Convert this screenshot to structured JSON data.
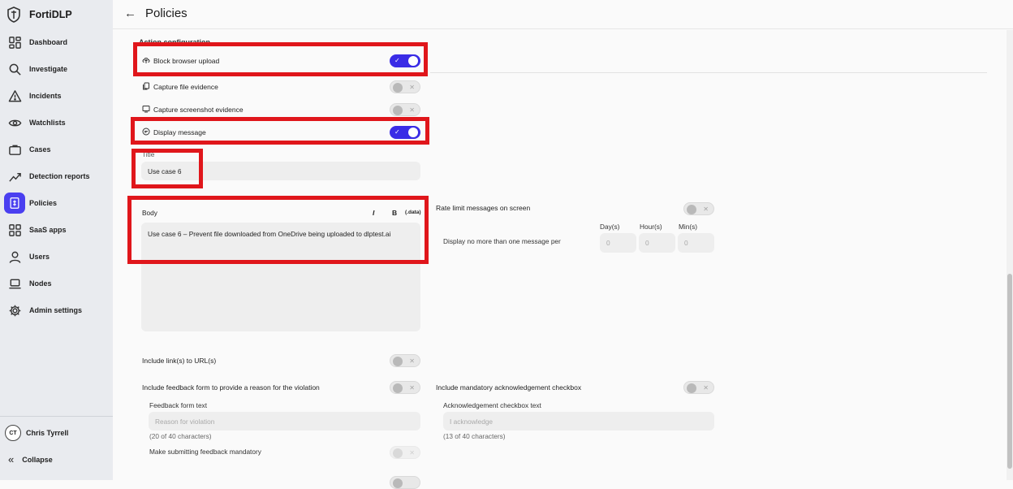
{
  "app": {
    "name": "FortiDLP"
  },
  "sidebar": {
    "items": [
      {
        "label": "Dashboard",
        "icon": "dashboard-icon"
      },
      {
        "label": "Investigate",
        "icon": "search-icon"
      },
      {
        "label": "Incidents",
        "icon": "warning-icon"
      },
      {
        "label": "Watchlists",
        "icon": "eye-icon"
      },
      {
        "label": "Cases",
        "icon": "briefcase-icon"
      },
      {
        "label": "Detection reports",
        "icon": "chart-line-icon"
      },
      {
        "label": "Policies",
        "icon": "policy-icon",
        "active": true
      },
      {
        "label": "SaaS apps",
        "icon": "apps-icon"
      },
      {
        "label": "Users",
        "icon": "user-icon"
      },
      {
        "label": "Nodes",
        "icon": "laptop-icon"
      },
      {
        "label": "Admin settings",
        "icon": "gear-icon"
      }
    ],
    "user": {
      "initials": "CT",
      "name": "Chris Tyrrell"
    },
    "collapse_label": "Collapse"
  },
  "header": {
    "title": "Policies"
  },
  "action_config": {
    "heading": "Action configuration",
    "block_browser_upload": {
      "label": "Block browser upload",
      "on": true
    },
    "capture_file_evidence": {
      "label": "Capture file evidence",
      "on": false
    },
    "capture_screenshot_evidence": {
      "label": "Capture screenshot evidence",
      "on": false
    },
    "display_message": {
      "label": "Display message",
      "on": true
    }
  },
  "message": {
    "title_label": "Title",
    "title_value": "Use case 6",
    "body_label": "Body",
    "format_italic": "I",
    "format_bold": "B",
    "format_data": "(.data)",
    "body_value": "Use case 6 – Prevent file downloaded from OneDrive being uploaded to dlptest.ai"
  },
  "rate_limit": {
    "label": "Rate limit messages on screen",
    "on": false,
    "description": "Display no more than one message per",
    "days_label": "Day(s)",
    "hours_label": "Hour(s)",
    "mins_label": "Min(s)",
    "days_value": "0",
    "hours_value": "0",
    "mins_value": "0"
  },
  "include_links": {
    "label": "Include link(s) to URL(s)",
    "on": false
  },
  "feedback": {
    "label": "Include feedback form to provide a reason for the violation",
    "on": false,
    "form_text_label": "Feedback form text",
    "placeholder": "Reason for violation",
    "char_count": "(20 of 40 characters)",
    "mandatory_label": "Make submitting feedback mandatory"
  },
  "acknowledgement": {
    "label": "Include mandatory acknowledgement checkbox",
    "on": false,
    "text_label": "Acknowledgement checkbox text",
    "placeholder": "I acknowledge",
    "char_count": "(13 of 40 characters)"
  },
  "colors": {
    "accent": "#3a2ce6",
    "highlight": "#e0161b",
    "sidebar": "#e9ebef"
  }
}
